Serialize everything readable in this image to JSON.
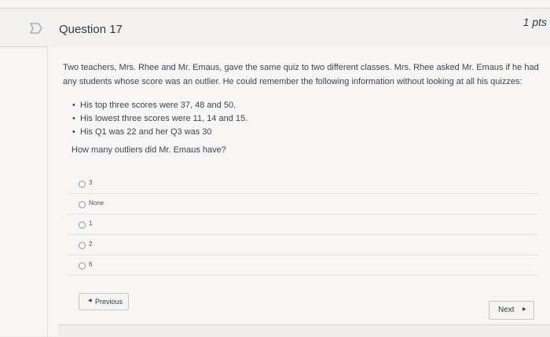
{
  "question": {
    "title": "Question 17",
    "points": "1 pts",
    "text": "Two teachers, Mrs. Rhee and Mr. Emaus, gave the same quiz to two different classes. Mrs. Rhee asked Mr. Emaus if he had any students whose score was an outlier. He could remember the following information without looking at all his quizzes:",
    "bullets": [
      "His top three scores were 37, 48 and 50.",
      "His lowest three scores were 11, 14 and 15.",
      "His Q1 was 22 and her Q3 was 30"
    ],
    "ask": "How many outliers did Mr. Emaus have?"
  },
  "answers": [
    "3",
    "None",
    "1",
    "2",
    "6"
  ],
  "nav": {
    "previous_label": "Previous",
    "next_label": "Next",
    "previous_icon": "left-triangle-icon",
    "next_icon": "right-triangle-icon"
  },
  "icons": {
    "flag": "flag-icon"
  }
}
